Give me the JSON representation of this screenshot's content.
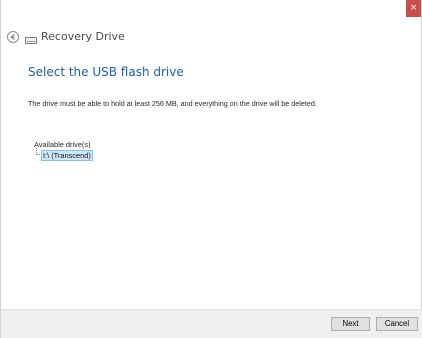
{
  "window": {
    "title": "Recovery Drive",
    "close_glyph": "×",
    "close_color": "#c94d4d"
  },
  "header": {
    "back_icon": "back-arrow-icon",
    "drive_icon": "drive-icon"
  },
  "main": {
    "heading": "Select the USB flash drive",
    "instructions": "The drive must be able to hold at least 256 MB, and everything on the drive will be deleted.",
    "drives_label": "Available drive(s)",
    "drives": [
      {
        "label": "I:\\ (Transcend)",
        "selected": true
      }
    ]
  },
  "footer": {
    "next_label": "Next",
    "cancel_label": "Cancel"
  },
  "theme": {
    "heading_color": "#1e5ea6",
    "selection_fill": "#cde8ff",
    "selection_border": "#84c0f0"
  }
}
